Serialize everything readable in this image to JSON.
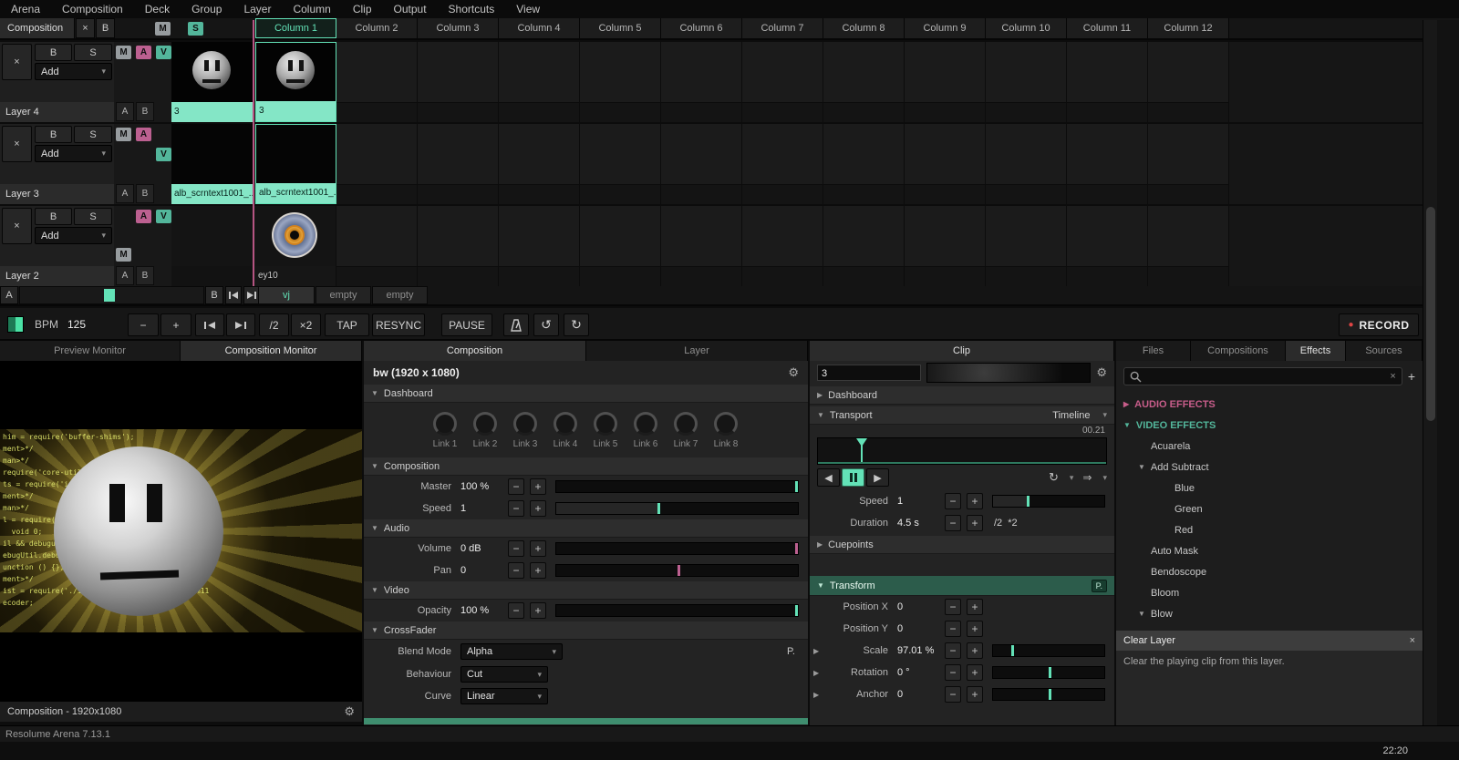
{
  "colors": {
    "accent_teal": "#63e2b7",
    "accent_pink": "#bc6090",
    "record_red": "#e04545"
  },
  "glyphs": {
    "close": "×",
    "minus": "−",
    "plus": "+",
    "caret": "▾",
    "tri_down": "▼",
    "tri_right": "▶",
    "tri_left": "◀",
    "play": "▶",
    "gear": "⚙",
    "undo": "↺",
    "redo": "↻",
    "record_dot": "●",
    "loop": "↻",
    "direction": "⇒"
  },
  "menubar": {
    "items": [
      "Arena",
      "Composition",
      "Deck",
      "Group",
      "Layer",
      "Column",
      "Clip",
      "Output",
      "Shortcuts",
      "View"
    ]
  },
  "grid": {
    "composition_tab": "Composition",
    "b": "B",
    "m": "M",
    "s": "S",
    "columns": [
      "Column 1",
      "Column 2",
      "Column 3",
      "Column 4",
      "Column 5",
      "Column 6",
      "Column 7",
      "Column 8",
      "Column 9",
      "Column 10",
      "Column 11",
      "Column 12"
    ]
  },
  "layers": {
    "layer4": {
      "name": "Layer 4",
      "blend": "Add",
      "b": "B",
      "s": "S",
      "m": "M",
      "a": "A",
      "v": "V",
      "ab_a": "A",
      "ab_b": "B",
      "active_clip_label": "3",
      "clip1_label": "3"
    },
    "layer3": {
      "name": "Layer 3",
      "blend": "Add",
      "b": "B",
      "s": "S",
      "m": "M",
      "a": "A",
      "v": "V",
      "ab_a": "A",
      "ab_b": "B",
      "active_clip_label": "alb_scrntext1001_...",
      "clip1_label": "alb_scrntext1001_..."
    },
    "layer2": {
      "name": "Layer 2",
      "blend": "Add",
      "b": "B",
      "s": "S",
      "m": "M",
      "a": "A",
      "v": "V",
      "ab_a": "A",
      "ab_b": "B",
      "clip1_label": "ey10"
    }
  },
  "deck": {
    "a": "A",
    "b": "B",
    "tabs": [
      "vj",
      "empty",
      "empty"
    ]
  },
  "transport": {
    "bpm_label": "BPM",
    "bpm_value": "125",
    "div2": "/2",
    "mul2": "×2",
    "tap": "TAP",
    "resync": "RESYNC",
    "pause": "PAUSE",
    "record": "RECORD"
  },
  "monitor": {
    "tabs": {
      "preview": "Preview Monitor",
      "composition": "Composition Monitor"
    },
    "footer": "Composition - 1920x1080",
    "code_lines": [
      "him = require('buffer-shims');",
      "ment>*/",
      "man>*/",
      "require('core-util-is');",
      "ts = require('inherits');",
      "ment>*/",
      "man>*/",
      "l = require('util');",
      "  void 0;",
      "il && debugutil.debu",
      "ebugUtil.debuglog('",
      "unction () {};",
      "ment>*/",
      "ist = require('./internal/st      erlist'); %11",
      "ecoder;"
    ]
  },
  "composition": {
    "tab": "Composition",
    "tab_layer": "Layer",
    "title": "bw (1920 x 1080)",
    "sections": {
      "dashboard": "Dashboard",
      "composition": "Composition",
      "audio": "Audio",
      "video": "Video",
      "crossfader": "CrossFader"
    },
    "links": [
      "Link 1",
      "Link 2",
      "Link 3",
      "Link 4",
      "Link 5",
      "Link 6",
      "Link 7",
      "Link 8"
    ],
    "master_label": "Master",
    "master_value": "100 %",
    "speed_label": "Speed",
    "speed_value": "1",
    "volume_label": "Volume",
    "volume_value": "0 dB",
    "pan_label": "Pan",
    "pan_value": "0",
    "opacity_label": "Opacity",
    "opacity_value": "100 %",
    "blend_label": "Blend Mode",
    "blend_value": "Alpha",
    "behaviour_label": "Behaviour",
    "behaviour_value": "Cut",
    "curve_label": "Curve",
    "curve_value": "Linear",
    "p_button": "P."
  },
  "clip": {
    "tab": "Clip",
    "name": "3",
    "sections": {
      "dashboard": "Dashboard",
      "transport": "Transport",
      "cuepoints": "Cuepoints",
      "transform": "Transform"
    },
    "timeline_mode": "Timeline",
    "timecode": "00.21",
    "speed_label": "Speed",
    "speed_value": "1",
    "duration_label": "Duration",
    "duration_value": "4.5 s",
    "div2": "/2",
    "mul2": "*2",
    "position_x_label": "Position X",
    "position_x_value": "0",
    "position_y_label": "Position Y",
    "position_y_value": "0",
    "scale_label": "Scale",
    "scale_value": "97.01 %",
    "rotation_label": "Rotation",
    "rotation_value": "0 °",
    "anchor_label": "Anchor",
    "anchor_value": "0",
    "p_button": "P."
  },
  "browser": {
    "tabs": [
      "Files",
      "Compositions",
      "Effects",
      "Sources"
    ],
    "audio_effects": "AUDIO EFFECTS",
    "video_effects": "VIDEO EFFECTS",
    "effects": [
      "Acuarela",
      "Add Subtract",
      "Blue",
      "Green",
      "Red",
      "Auto Mask",
      "Bendoscope",
      "Bloom",
      "Blow"
    ],
    "clear_layer_title": "Clear Layer",
    "clear_layer_desc": "Clear the playing clip from this layer."
  },
  "status": {
    "app": "Resolume Arena 7.13.1",
    "clock": "22:20"
  }
}
